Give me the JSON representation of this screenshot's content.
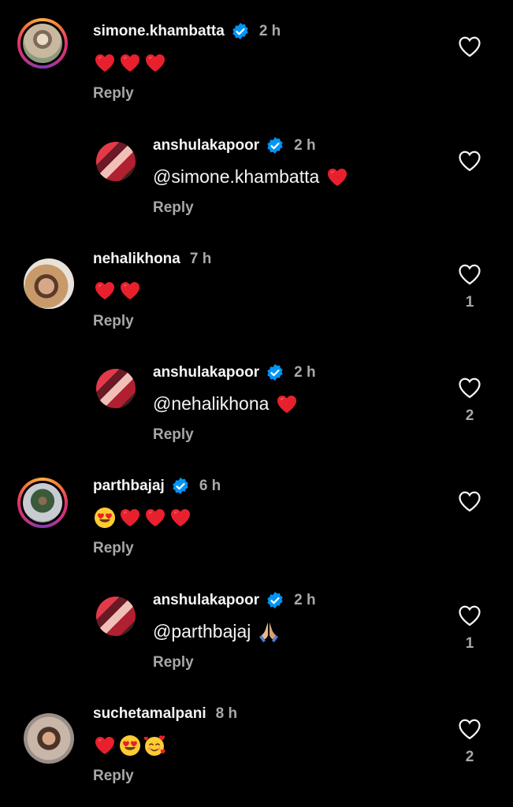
{
  "comments": [
    {
      "username": "simone.khambatta",
      "verified": true,
      "time": "2 h",
      "text": "",
      "emojis": [
        "heart",
        "heart",
        "heart"
      ],
      "reply_label": "Reply",
      "likes": ""
    },
    {
      "username": "anshulakapoor",
      "verified": true,
      "time": "2 h",
      "text": "@simone.khambatta",
      "emojis": [
        "heart"
      ],
      "reply_label": "Reply",
      "likes": ""
    },
    {
      "username": "nehalikhona",
      "verified": false,
      "time": "7 h",
      "text": "",
      "emojis": [
        "heart",
        "heart"
      ],
      "reply_label": "Reply",
      "likes": "1"
    },
    {
      "username": "anshulakapoor",
      "verified": true,
      "time": "2 h",
      "text": "@nehalikhona",
      "emojis": [
        "heart"
      ],
      "reply_label": "Reply",
      "likes": "2"
    },
    {
      "username": "parthbajaj",
      "verified": true,
      "time": "6 h",
      "text": "",
      "emojis": [
        "heart-eyes",
        "heart",
        "heart",
        "heart"
      ],
      "reply_label": "Reply",
      "likes": ""
    },
    {
      "username": "anshulakapoor",
      "verified": true,
      "time": "2 h",
      "text": "@parthbajaj",
      "emojis": [
        "folded-hands"
      ],
      "reply_label": "Reply",
      "likes": "1"
    },
    {
      "username": "suchetamalpani",
      "verified": false,
      "time": "8 h",
      "text": "",
      "emojis": [
        "heart",
        "heart-eyes",
        "smiling-face-with-hearts"
      ],
      "reply_label": "Reply",
      "likes": "2"
    }
  ],
  "colors": {
    "background": "#000000",
    "text": "#f5f5f5",
    "muted": "#a8a8a8",
    "verified": "#0095f6",
    "heart": "#e8202e"
  }
}
